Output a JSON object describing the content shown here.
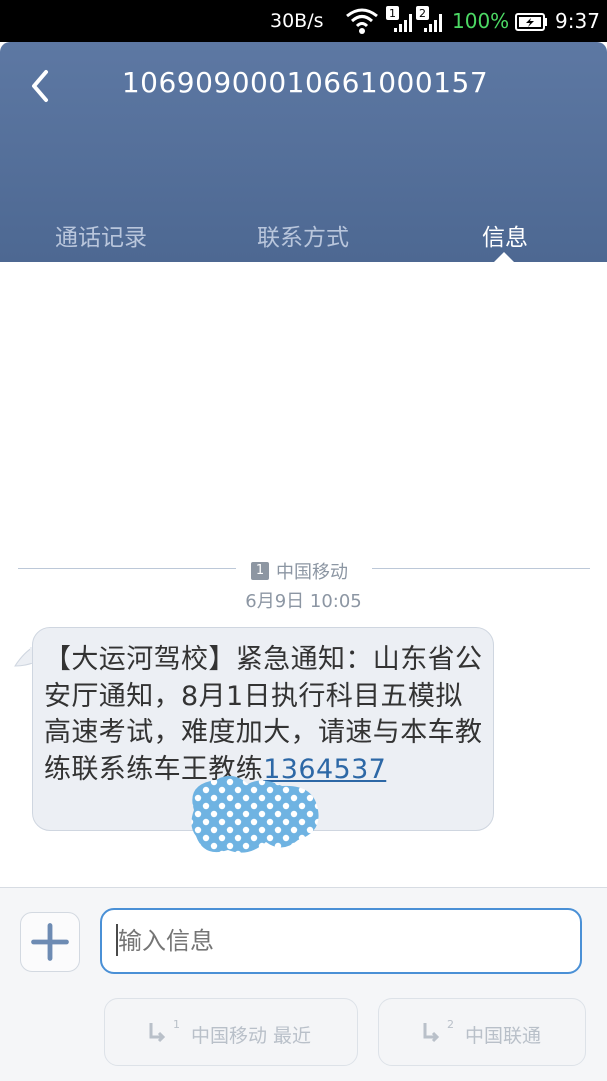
{
  "status_bar": {
    "speed": "30B/s",
    "sim1": "1",
    "sim2": "2",
    "battery": "100%",
    "time": "9:37",
    "icons": [
      "wifi-icon",
      "signal-icon",
      "battery-icon"
    ],
    "battery_color": "#4cd964"
  },
  "header": {
    "contact": "1069090001066100015​7",
    "tabs": [
      "通话记录",
      "联系方式",
      "信息"
    ],
    "active_tab": "信息",
    "bg_color": "#5a74a0"
  },
  "conversation": {
    "sim_badge": "1",
    "carrier": "中国移动",
    "time": "6月9日 10:05",
    "message_text": "【大运河驾校】紧急通知：山东省公安厅通知，8月1日执行科目五模拟高速考试，难度加大，请速与本车教练联系练车王教练",
    "phone_visible": "1364537"
  },
  "compose": {
    "placeholder": "输入信息",
    "send_sim1_label": "中国移动 最近",
    "send_sim2_label": "中国联通",
    "sim1": "1",
    "sim2": "2",
    "accent_color": "#4a90d6"
  }
}
